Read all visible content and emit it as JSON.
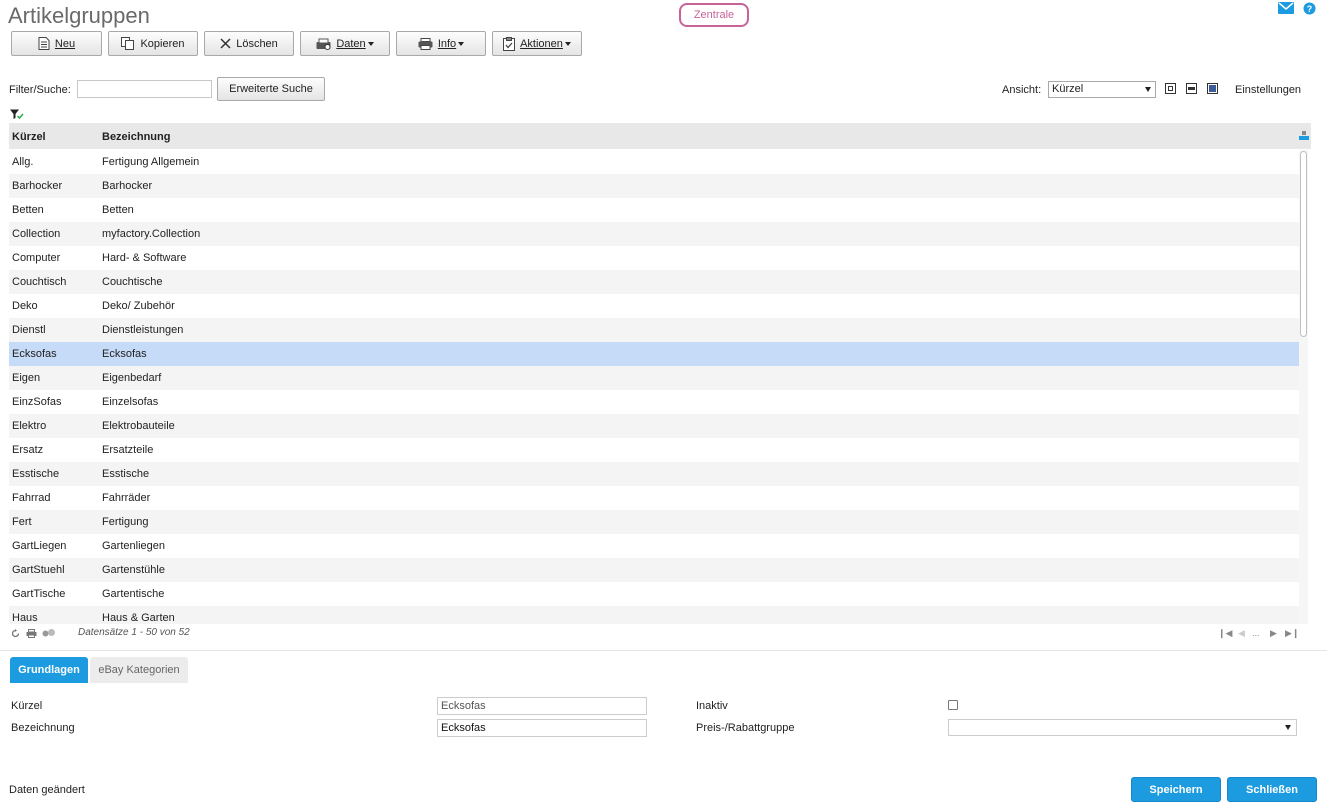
{
  "page": {
    "title": "Artikelgruppen",
    "context_badge": "Zentrale"
  },
  "toolbar": {
    "neu": "Neu",
    "kopieren": "Kopieren",
    "loeschen": "Löschen",
    "daten": "Daten",
    "info": "Info",
    "aktionen": "Aktionen"
  },
  "filter": {
    "label": "Filter/Suche:",
    "value": "",
    "placeholder": "",
    "extended_search": "Erweiterte Suche",
    "view_label": "Ansicht:",
    "view_value": "Kürzel",
    "settings": "Einstellungen"
  },
  "grid": {
    "columns": [
      "Kürzel",
      "Bezeichnung"
    ],
    "rows": [
      {
        "kuerzel": "Allg.",
        "bezeichnung": "Fertigung Allgemein"
      },
      {
        "kuerzel": "Barhocker",
        "bezeichnung": "Barhocker"
      },
      {
        "kuerzel": "Betten",
        "bezeichnung": "Betten"
      },
      {
        "kuerzel": "Collection",
        "bezeichnung": "myfactory.Collection"
      },
      {
        "kuerzel": "Computer",
        "bezeichnung": "Hard- & Software"
      },
      {
        "kuerzel": "Couchtisch",
        "bezeichnung": "Couchtische"
      },
      {
        "kuerzel": "Deko",
        "bezeichnung": "Deko/ Zubehör"
      },
      {
        "kuerzel": "Dienstl",
        "bezeichnung": "Dienstleistungen"
      },
      {
        "kuerzel": "Ecksofas",
        "bezeichnung": "Ecksofas"
      },
      {
        "kuerzel": "Eigen",
        "bezeichnung": "Eigenbedarf"
      },
      {
        "kuerzel": "EinzSofas",
        "bezeichnung": "Einzelsofas"
      },
      {
        "kuerzel": "Elektro",
        "bezeichnung": "Elektrobauteile"
      },
      {
        "kuerzel": "Ersatz",
        "bezeichnung": "Ersatzteile"
      },
      {
        "kuerzel": "Esstische",
        "bezeichnung": "Esstische"
      },
      {
        "kuerzel": "Fahrrad",
        "bezeichnung": "Fahrräder"
      },
      {
        "kuerzel": "Fert",
        "bezeichnung": "Fertigung"
      },
      {
        "kuerzel": "GartLiegen",
        "bezeichnung": "Gartenliegen"
      },
      {
        "kuerzel": "GartStuehl",
        "bezeichnung": "Gartenstühle"
      },
      {
        "kuerzel": "GartTische",
        "bezeichnung": "Gartentische"
      },
      {
        "kuerzel": "Haus",
        "bezeichnung": "Haus & Garten"
      }
    ],
    "selected_index": 8,
    "record_status": "Datensätze 1 - 50 von 52",
    "pager_ellipsis": "..."
  },
  "tabs": {
    "grundlagen": "Grundlagen",
    "ebay": "eBay Kategorien"
  },
  "form": {
    "kuerzel_label": "Kürzel",
    "kuerzel_value": "Ecksofas",
    "bezeichnung_label": "Bezeichnung",
    "bezeichnung_value": "Ecksofas",
    "inaktiv_label": "Inaktiv",
    "preis_label": "Preis-/Rabattgruppe",
    "preis_value": ""
  },
  "footer": {
    "status": "Daten geändert",
    "save": "Speichern",
    "close": "Schließen"
  },
  "colors": {
    "accent": "#1c9be0",
    "badge": "#c8639a",
    "selected_row": "#c6dbf7"
  },
  "icons": [
    "mail-icon",
    "help-icon",
    "new-document-icon",
    "copy-icon",
    "delete-x-icon",
    "data-icon",
    "printer-icon",
    "clipboard-icon",
    "filter-icon",
    "column-chooser-icon",
    "refresh-icon",
    "print-icon",
    "group-icon"
  ]
}
